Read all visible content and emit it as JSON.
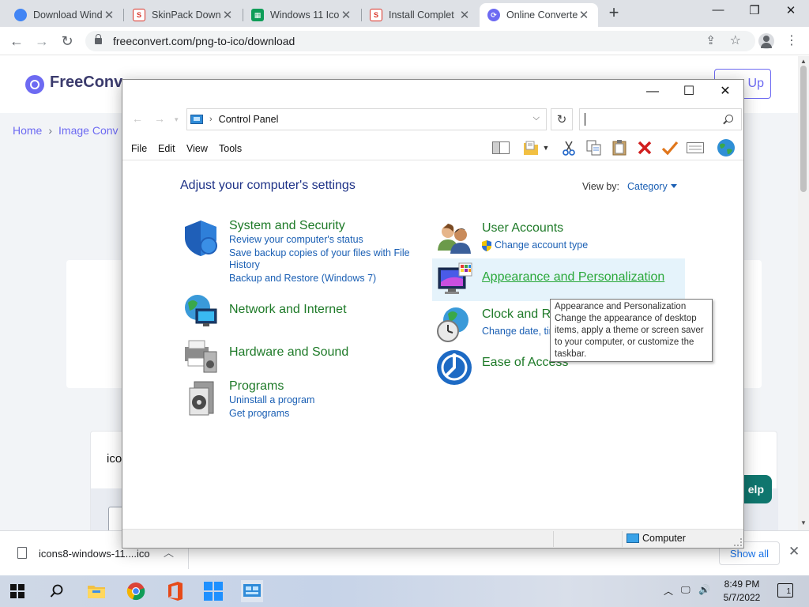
{
  "browser": {
    "tabs": [
      {
        "title": "Download Wind",
        "favicon": "chrome-icon",
        "color": "#4285f4"
      },
      {
        "title": "SkinPack Downl",
        "favicon": "skinpack-icon",
        "color": "#d93025"
      },
      {
        "title": "Windows 11 Ico",
        "favicon": "sheets-icon",
        "color": "#0f9d58"
      },
      {
        "title": "Install Complet",
        "favicon": "skinpack-icon",
        "color": "#d93025"
      },
      {
        "title": "Online Converte",
        "favicon": "freeconvert-icon",
        "color": "#6d6af2"
      }
    ],
    "url": "freeconvert.com/png-to-ico/download"
  },
  "page": {
    "brand": {
      "part1": "Free",
      "part2": "Conv"
    },
    "signup": "n Up",
    "breadcrumb": [
      "Home",
      "Image Conv"
    ],
    "card_label": "ico",
    "help": "elp"
  },
  "downloads": {
    "file": "icons8-windows-11....ico",
    "show_all": "Show all"
  },
  "taskbar": {
    "time": "8:49 PM",
    "date": "5/7/2022",
    "notifications": "1"
  },
  "control_panel": {
    "address": "Control Panel",
    "menu": [
      "File",
      "Edit",
      "View",
      "Tools"
    ],
    "heading": "Adjust your computer's settings",
    "view_by_label": "View by:",
    "view_by_value": "Category",
    "categories": {
      "system": {
        "title": "System and Security",
        "links": [
          "Review your computer's status",
          "Save backup copies of your files with File",
          "History",
          "Backup and Restore (Windows 7)"
        ]
      },
      "network": {
        "title": "Network and Internet"
      },
      "hardware": {
        "title": "Hardware and Sound"
      },
      "programs": {
        "title": "Programs",
        "links": [
          "Uninstall a program",
          "Get programs"
        ]
      },
      "users": {
        "title": "User Accounts",
        "links": [
          "Change account type"
        ]
      },
      "appearance": {
        "title": "Appearance and Personalization"
      },
      "clock": {
        "title": "Clock and Re",
        "links": [
          "Change date, tim"
        ]
      },
      "ease": {
        "title": "Ease of Access"
      }
    },
    "tooltip": {
      "title": "Appearance and Personalization",
      "body": [
        "Change the appearance of desktop",
        "items, apply a theme or screen saver",
        "to your computer, or customize the",
        "taskbar."
      ]
    },
    "status": "Computer"
  },
  "colors": {
    "accent": "#6d6af2",
    "cp_title_green": "#1e7a28",
    "cp_link_blue": "#1a5fb4"
  }
}
